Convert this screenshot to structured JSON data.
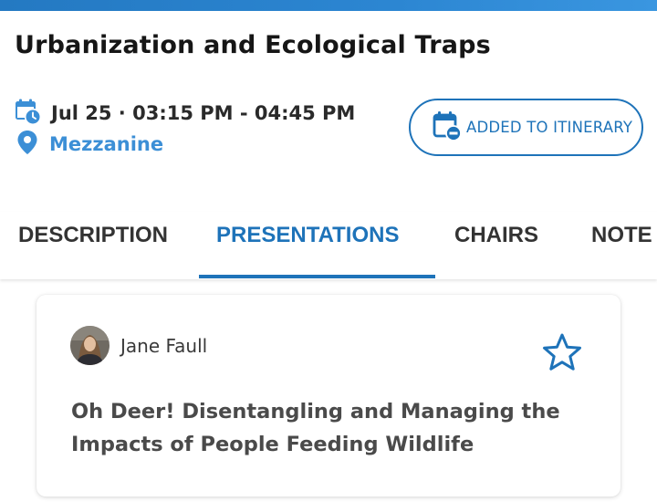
{
  "session": {
    "title": "Urbanization and Ecological Traps",
    "datetime": "Jul 25 · 03:15 PM - 04:45 PM",
    "location": "Mezzanine",
    "itinerary_button": "ADDED TO ITINERARY"
  },
  "tabs": [
    {
      "label": "DESCRIPTION"
    },
    {
      "label": "PRESENTATIONS"
    },
    {
      "label": "CHAIRS"
    },
    {
      "label": "NOTE"
    }
  ],
  "active_tab": "PRESENTATIONS",
  "presentation": {
    "author": "Jane Faull",
    "title": "Oh Deer! Disentangling and Managing the Impacts of People Feeding Wildlife",
    "favorited": false
  },
  "icons": {
    "time": "calendar-clock-icon",
    "location": "map-pin-icon",
    "itinerary": "calendar-remove-icon",
    "favorite": "star-outline-icon"
  },
  "colors": {
    "accent": "#1e73b9",
    "location": "#3c8fd6",
    "header_bar": "#2c86d2"
  }
}
